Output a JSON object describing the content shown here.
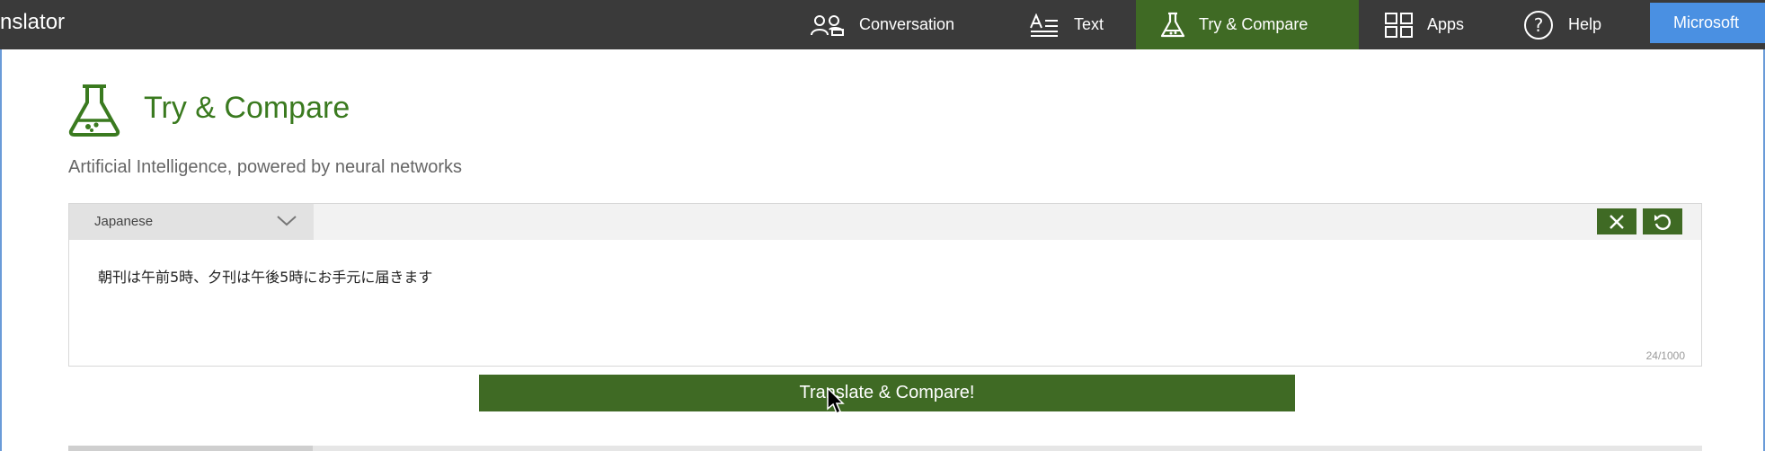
{
  "app": {
    "brand": "nslator"
  },
  "nav": {
    "conversation": "Conversation",
    "text": "Text",
    "try_compare": "Try & Compare",
    "apps": "Apps",
    "help": "Help",
    "microsoft": "Microsoft"
  },
  "page": {
    "title": "Try & Compare",
    "subtitle": "Artificial Intelligence, powered by neural networks"
  },
  "translator": {
    "source_language": "Japanese",
    "source_text": "朝刊は午前5時、夕刊は午後5時にお手元に届きます",
    "char_count": "24/1000",
    "translate_label": "Translate & Compare!"
  },
  "colors": {
    "accent_green": "#3f6a24",
    "title_green": "#3a7a1f",
    "topbar": "#3a3a3a",
    "microsoft_blue": "#4a90e2"
  },
  "icons": [
    "conversation-icon",
    "text-icon",
    "flask-icon",
    "apps-icon",
    "help-icon",
    "close-icon",
    "undo-icon",
    "chevron-down-icon",
    "cursor-icon"
  ]
}
